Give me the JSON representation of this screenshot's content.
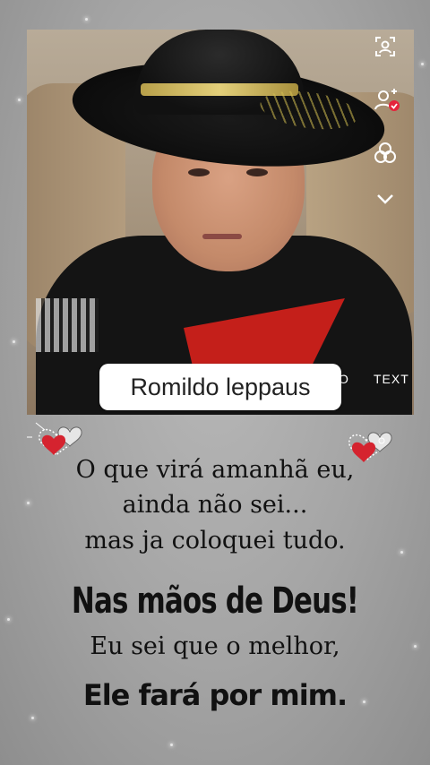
{
  "photo": {
    "name_tag": "Romildo leppaus",
    "tools": {
      "text_label": "TEXT",
      "partial_label": "O"
    },
    "icons": [
      "profile-frame-icon",
      "add-person-icon",
      "effects-icon",
      "chevron-down-icon"
    ]
  },
  "message": {
    "line1": "O que virá amanhã eu,",
    "line2": "ainda não sei...",
    "line3": "mas ja coloquei tudo.",
    "line4": "Nas mãos de Deus!",
    "line5": "Eu sei que o melhor,",
    "line6": "Ele fará por mim."
  },
  "colors": {
    "background": "#a4a4a4",
    "accent_red": "#c41f1a",
    "notification": "#e5243b"
  }
}
